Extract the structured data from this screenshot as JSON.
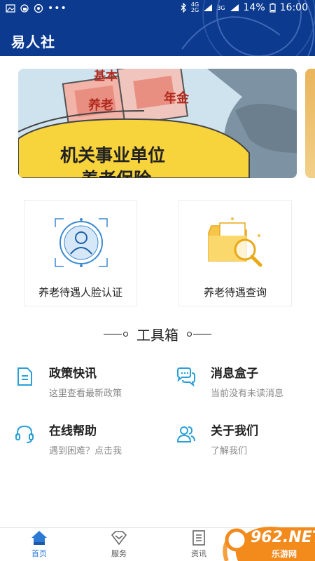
{
  "status_bar": {
    "network_top": "4G",
    "network_bottom": "2G",
    "network2_top": "3G",
    "battery": "14%",
    "time": "16:00"
  },
  "app": {
    "title": "易人社"
  },
  "banner": {
    "line1": "机关事业单位",
    "line2": "养老保险",
    "tags": [
      "基本",
      "养老",
      "年金"
    ]
  },
  "cards": [
    {
      "label": "养老待遇人脸认证",
      "icon": "face-recognition-icon"
    },
    {
      "label": "养老待遇查询",
      "icon": "folder-search-icon"
    }
  ],
  "tools_section": {
    "title": "工具箱"
  },
  "tools": [
    {
      "title": "政策快讯",
      "subtitle": "这里查看最新政策",
      "icon": "document-icon"
    },
    {
      "title": "消息盒子",
      "subtitle": "当前没有未读消息",
      "icon": "chat-bubbles-icon"
    },
    {
      "title": "在线帮助",
      "subtitle": "遇到困难？点击我",
      "icon": "headset-icon"
    },
    {
      "title": "关于我们",
      "subtitle": "了解我们",
      "icon": "users-icon"
    }
  ],
  "bottom_nav": [
    {
      "label": "首页",
      "icon": "home-icon",
      "active": true
    },
    {
      "label": "服务",
      "icon": "diamond-icon",
      "active": false
    },
    {
      "label": "资讯",
      "icon": "news-list-icon",
      "active": false
    }
  ],
  "watermark": {
    "text": "962.NET",
    "sub": "乐游网"
  },
  "colors": {
    "header": "#0b3a8f",
    "accent": "#2a7ad5",
    "icon_teal": "#2a9fd6"
  }
}
